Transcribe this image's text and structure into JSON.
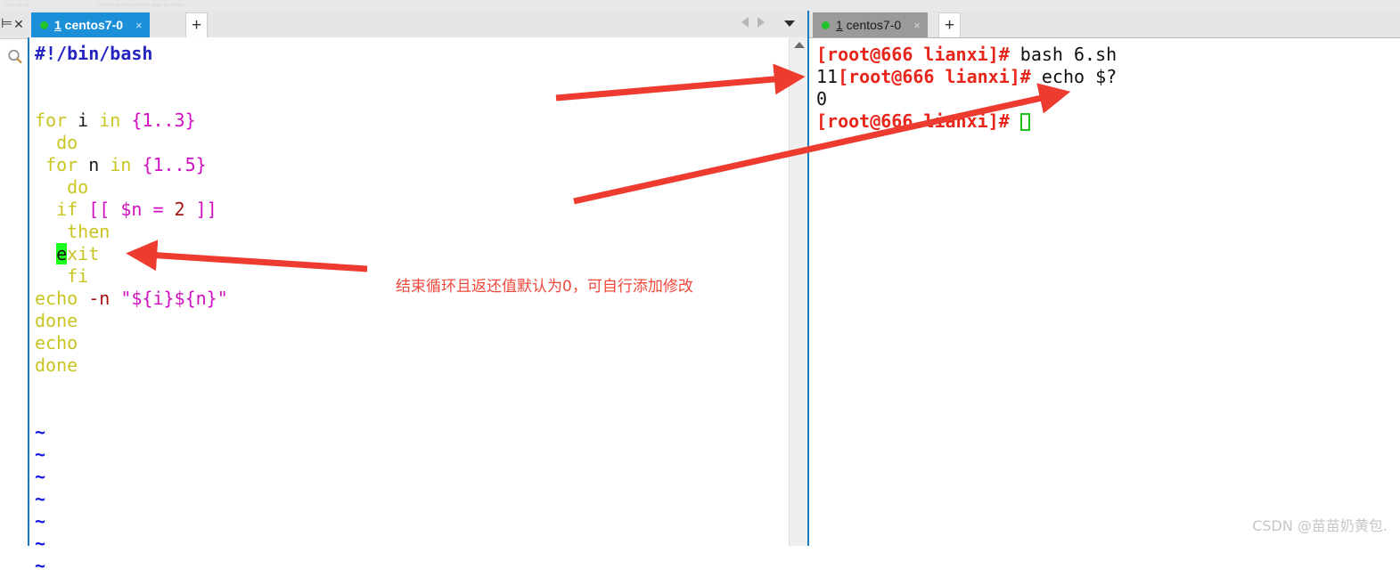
{
  "window": {
    "ghost_toolbar_hint": "",
    "watermark": "CSDN @苗苗奶黄包."
  },
  "left_rail": {
    "pin_icon": "pin-icon",
    "close_icon": "close-icon",
    "search_icon": "search-icon"
  },
  "editor": {
    "tab": {
      "number": "1",
      "name": " centos7-0",
      "close": "×",
      "status_dot": "connected"
    },
    "add_tab_label": "+",
    "nav_prev_icon": "chevron-left-icon",
    "nav_next_icon": "chevron-right-icon",
    "dropdown_icon": "chevron-down-icon",
    "scroll_up_icon": "scroll-up-arrow",
    "code_lines": [
      {
        "id": "l1",
        "segments": [
          {
            "t": "#!/bin/bash",
            "c": "k-hash"
          }
        ]
      },
      {
        "id": "l2",
        "segments": [
          {
            "t": "",
            "c": ""
          }
        ]
      },
      {
        "id": "l3",
        "segments": [
          {
            "t": "",
            "c": ""
          }
        ]
      },
      {
        "id": "l4",
        "segments": [
          {
            "t": "for ",
            "c": "k-kw"
          },
          {
            "t": "i ",
            "c": "k-var"
          },
          {
            "t": "in ",
            "c": "k-kw"
          },
          {
            "t": "{1..3}",
            "c": "k-brace"
          }
        ]
      },
      {
        "id": "l5",
        "segments": [
          {
            "t": "  do",
            "c": "k-kw"
          }
        ]
      },
      {
        "id": "l6",
        "segments": [
          {
            "t": " for ",
            "c": "k-kw"
          },
          {
            "t": "n ",
            "c": "k-var"
          },
          {
            "t": "in ",
            "c": "k-kw"
          },
          {
            "t": "{1..5}",
            "c": "k-brace"
          }
        ]
      },
      {
        "id": "l7",
        "segments": [
          {
            "t": "   do",
            "c": "k-kw"
          }
        ]
      },
      {
        "id": "l8",
        "segments": [
          {
            "t": "  if ",
            "c": "k-kw"
          },
          {
            "t": "[[ $n = ",
            "c": "k-brace"
          },
          {
            "t": "2",
            "c": "k-red"
          },
          {
            "t": " ]]",
            "c": "k-brace"
          }
        ]
      },
      {
        "id": "l9",
        "segments": [
          {
            "t": "   then",
            "c": "k-kw"
          }
        ]
      },
      {
        "id": "l10",
        "segments": [
          {
            "t": "  ",
            "c": ""
          },
          {
            "t": "e",
            "c": "k-cursor"
          },
          {
            "t": "xit",
            "c": "k-kw"
          }
        ]
      },
      {
        "id": "l11",
        "segments": [
          {
            "t": "   fi",
            "c": "k-kw"
          }
        ]
      },
      {
        "id": "l12",
        "segments": [
          {
            "t": "echo ",
            "c": "k-kw"
          },
          {
            "t": "-n ",
            "c": "k-red"
          },
          {
            "t": "\"${i}${n}\"",
            "c": "k-brace"
          }
        ]
      },
      {
        "id": "l13",
        "segments": [
          {
            "t": "done",
            "c": "k-kw"
          }
        ]
      },
      {
        "id": "l14",
        "segments": [
          {
            "t": "echo",
            "c": "k-kw"
          }
        ]
      },
      {
        "id": "l15",
        "segments": [
          {
            "t": "done",
            "c": "k-kw"
          }
        ]
      },
      {
        "id": "l16",
        "segments": [
          {
            "t": "",
            "c": ""
          }
        ]
      },
      {
        "id": "l17",
        "segments": [
          {
            "t": "",
            "c": ""
          }
        ]
      },
      {
        "id": "l18",
        "segments": [
          {
            "t": "~",
            "c": "k-tilde"
          }
        ]
      },
      {
        "id": "l19",
        "segments": [
          {
            "t": "~",
            "c": "k-tilde"
          }
        ]
      },
      {
        "id": "l20",
        "segments": [
          {
            "t": "~",
            "c": "k-tilde"
          }
        ]
      },
      {
        "id": "l21",
        "segments": [
          {
            "t": "~",
            "c": "k-tilde"
          }
        ]
      },
      {
        "id": "l22",
        "segments": [
          {
            "t": "~",
            "c": "k-tilde"
          }
        ]
      },
      {
        "id": "l23",
        "segments": [
          {
            "t": "~",
            "c": "k-tilde"
          }
        ]
      },
      {
        "id": "l24",
        "segments": [
          {
            "t": "~",
            "c": "k-tilde"
          }
        ]
      }
    ]
  },
  "terminal": {
    "tab": {
      "number": "1",
      "name": " centos7-0",
      "close": "×",
      "status_dot": "connected"
    },
    "add_tab_label": "+",
    "lines": [
      {
        "id": "t1",
        "segments": [
          {
            "t": "[root@666 lianxi]#",
            "c": "t-prompt"
          },
          {
            "t": " bash 6.sh",
            "c": "t-cmd"
          }
        ]
      },
      {
        "id": "t2",
        "segments": [
          {
            "t": "11",
            "c": "t-cmd"
          },
          {
            "t": "[root@666 lianxi]#",
            "c": "t-prompt"
          },
          {
            "t": " echo $?",
            "c": "t-cmd"
          }
        ]
      },
      {
        "id": "t3",
        "segments": [
          {
            "t": "0",
            "c": "t-cmd"
          }
        ]
      },
      {
        "id": "t4",
        "segments": [
          {
            "t": "[root@666 lianxi]#",
            "c": "t-prompt"
          },
          {
            "t": " ",
            "c": "t-cmd"
          },
          {
            "t": "",
            "c": "t-cursor"
          }
        ]
      }
    ]
  },
  "annotations": {
    "accent_color": "#ee3b30",
    "note_text": "结束循环且返还值默认为0，可自行添加修改",
    "arrows": [
      {
        "name": "arrow-to-exit-keyword"
      },
      {
        "name": "arrow-to-script-output"
      },
      {
        "name": "arrow-to-exit-status"
      }
    ]
  }
}
